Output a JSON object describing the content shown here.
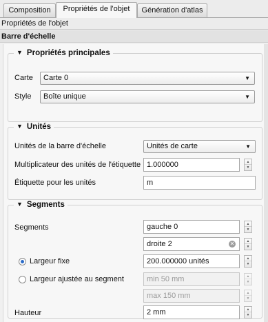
{
  "tabs": [
    {
      "label": "Composition",
      "active": false
    },
    {
      "label": "Propriétés de l'objet",
      "active": true
    },
    {
      "label": "Génération d'atlas",
      "active": false
    }
  ],
  "panel_header": "Propriétés de l'objet",
  "section_title": "Barre d'échelle",
  "main_props": {
    "title": "Propriétés principales",
    "map_label": "Carte",
    "map_value": "Carte 0",
    "style_label": "Style",
    "style_value": "Boîte unique"
  },
  "units": {
    "title": "Unités",
    "bar_units_label": "Unités de la barre d'échelle",
    "bar_units_value": "Unités de carte",
    "multiplier_label": "Multiplicateur des unités de l'étiquette",
    "multiplier_value": "1.000000",
    "label_units_label": "Étiquette pour les unités",
    "label_units_value": "m"
  },
  "segments": {
    "title": "Segments",
    "segments_label": "Segments",
    "left_value": "gauche 0",
    "right_value": "droite 2",
    "fixed_width_label": "Largeur fixe",
    "fixed_width_value": "200.000000 unités",
    "fit_width_label": "Largeur ajustée au segment",
    "min_value": "min 50 mm",
    "max_value": "max 150 mm",
    "height_label": "Hauteur",
    "height_value": "2 mm"
  },
  "icons": {
    "collapse": "▼",
    "dropdown": "▼",
    "spin_up": "▲",
    "spin_down": "▼",
    "clear": "✕"
  },
  "colors": {
    "radio_accent": "#2a6bc8"
  }
}
